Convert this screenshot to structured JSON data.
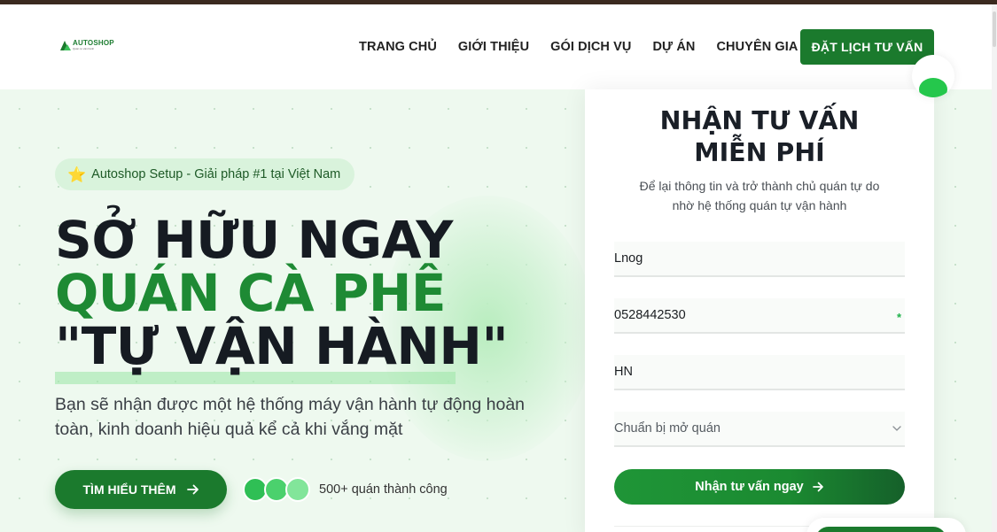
{
  "brand": {
    "logo_word": "AUTOSHOP",
    "logo_tagline": "Quán tự vận hành",
    "primary_color": "#1b7a2d",
    "accent_color": "#1e8a34"
  },
  "nav": {
    "items": [
      "TRANG CHỦ",
      "GIỚI THIỆU",
      "GÓI DỊCH VỤ",
      "DỰ ÁN",
      "CHUYÊN GIA"
    ],
    "cta_label": "ĐẶT LỊCH TƯ VẤN"
  },
  "hero": {
    "badge_icon": "star-icon",
    "badge_text": "Autoshop Setup - Giải pháp #1 tại Việt Nam",
    "headline_line1": "SỞ HỮU NGAY",
    "headline_line2": "QUÁN CÀ PHÊ",
    "headline_line3": "\"TỰ VẬN HÀNH\"",
    "subtext": "Bạn sẽ nhận được một hệ thống máy vận hành tự động hoàn toàn, kinh doanh hiệu quả kể cả khi vắng mặt",
    "cta_label": "TÌM HIỂU THÊM",
    "cta_icon": "arrow-right-icon",
    "social_proof": "500+ quán thành công"
  },
  "form": {
    "title": "NHẬN TƯ VẤN MIỄN PHÍ",
    "description": "Để lại thông tin và trở thành chủ quán tự do nhờ hệ thống quán tự vận hành",
    "name_value": "Lnog",
    "phone_value": "0528442530",
    "phone_required_mark": "*",
    "city_value": "HN",
    "status_selected": "Chuẩn bị mở quán",
    "submit_label": "Nhận tư vấn ngay",
    "submit_icon": "arrow-right-icon"
  }
}
